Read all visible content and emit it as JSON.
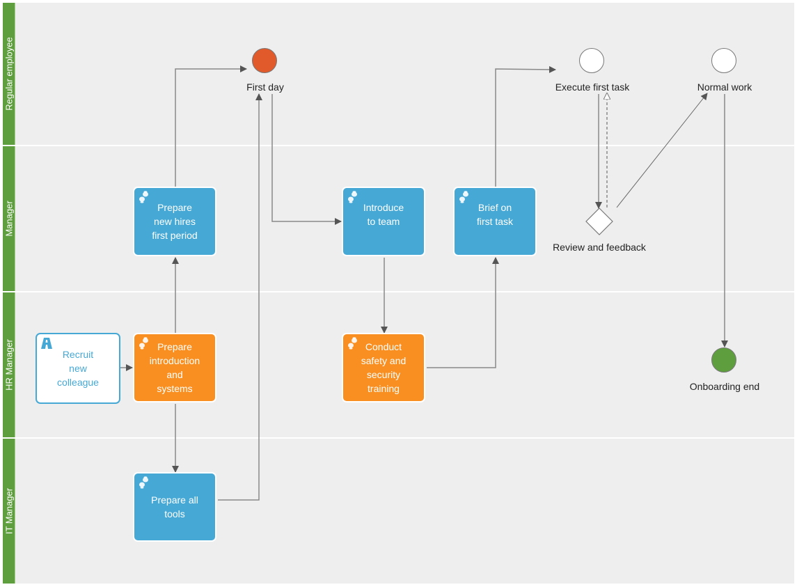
{
  "diagram": {
    "type": "swimlane-process",
    "lanes": [
      {
        "id": "regular-employee",
        "label": "Regular employee"
      },
      {
        "id": "manager",
        "label": "Manager"
      },
      {
        "id": "hr-manager",
        "label": "HR Manager"
      },
      {
        "id": "it-manager",
        "label": "IT Manager"
      }
    ],
    "tasks": {
      "recruit": {
        "label": "Recruit\nnew\ncolleague",
        "lane": "hr-manager",
        "style": "outline",
        "icon": "road-icon"
      },
      "prepare_intro": {
        "label": "Prepare\nintroduction\nand\nsystems",
        "lane": "hr-manager",
        "style": "orange",
        "icon": "footsteps-icon"
      },
      "prepare_hires": {
        "label": "Prepare\nnew hires\nfirst period",
        "lane": "manager",
        "style": "blue",
        "icon": "footsteps-icon"
      },
      "prepare_tools": {
        "label": "Prepare all\ntools",
        "lane": "it-manager",
        "style": "blue",
        "icon": "footsteps-icon"
      },
      "introduce": {
        "label": "Introduce\nto team",
        "lane": "manager",
        "style": "blue",
        "icon": "footsteps-icon"
      },
      "conduct": {
        "label": "Conduct\nsafety and\nsecurity\ntraining",
        "lane": "hr-manager",
        "style": "orange",
        "icon": "footsteps-icon"
      },
      "brief": {
        "label": "Brief on\nfirst task",
        "lane": "manager",
        "style": "blue",
        "icon": "footsteps-icon"
      }
    },
    "events": {
      "first_day": {
        "label": "First day",
        "lane": "regular-employee",
        "color": "#e05a2b"
      },
      "execute": {
        "label": "Execute first task",
        "lane": "regular-employee",
        "color": "#ffffff"
      },
      "normal": {
        "label": "Normal work",
        "lane": "regular-employee",
        "color": "#ffffff"
      },
      "end": {
        "label": "Onboarding end",
        "lane": "hr-manager",
        "color": "#5f9e3e"
      }
    },
    "gateway": {
      "label": "Review and feedback",
      "lane": "manager"
    },
    "flows": [
      {
        "from": "recruit",
        "to": "prepare_intro"
      },
      {
        "from": "prepare_intro",
        "to": "prepare_hires"
      },
      {
        "from": "prepare_intro",
        "to": "prepare_tools"
      },
      {
        "from": "prepare_hires",
        "to": "first_day"
      },
      {
        "from": "prepare_tools",
        "to": "first_day"
      },
      {
        "from": "first_day",
        "to": "introduce"
      },
      {
        "from": "introduce",
        "to": "conduct"
      },
      {
        "from": "conduct",
        "to": "brief"
      },
      {
        "from": "brief",
        "to": "execute"
      },
      {
        "from": "execute",
        "to": "review"
      },
      {
        "from": "review",
        "to": "execute",
        "style": "dashed"
      },
      {
        "from": "review",
        "to": "normal"
      },
      {
        "from": "normal",
        "to": "end"
      }
    ]
  },
  "colors": {
    "lane_header": "#5f9e3e",
    "task_blue": "#46a8d5",
    "task_orange": "#f88f20",
    "edge": "#888888",
    "arrowhead": "#555555"
  }
}
